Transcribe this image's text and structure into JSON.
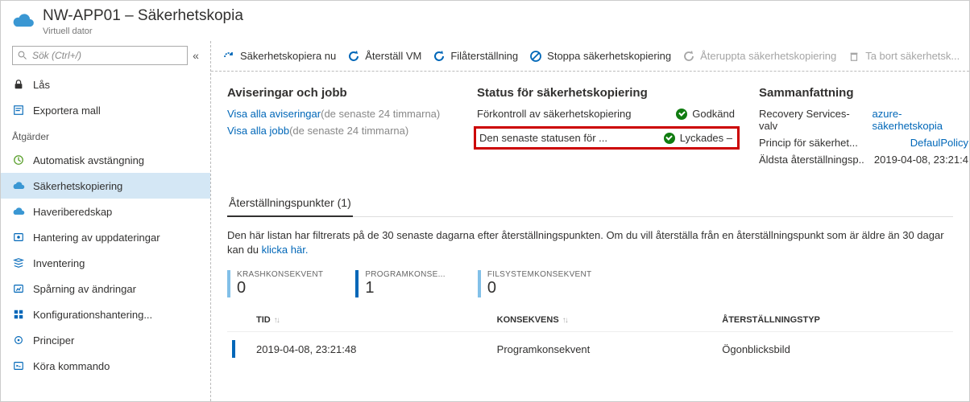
{
  "header": {
    "title": "NW-APP01 – Säkerhetskopia",
    "subtitle": "Virtuell dator"
  },
  "search": {
    "placeholder": "Sök (Ctrl+/)"
  },
  "sidebar": {
    "basic": [
      {
        "icon": "lock",
        "label": "Lås"
      },
      {
        "icon": "export",
        "label": "Exportera mall"
      }
    ],
    "section_label": "Åtgärder",
    "ops": [
      {
        "icon": "clock",
        "label": "Automatisk avstängning"
      },
      {
        "icon": "cloud",
        "label": "Säkerhetskopiering",
        "active": true
      },
      {
        "icon": "cloud",
        "label": "Haveriberedskap"
      },
      {
        "icon": "updates",
        "label": "Hantering av uppdateringar"
      },
      {
        "icon": "stack",
        "label": "Inventering"
      },
      {
        "icon": "track",
        "label": "Spårning av ändringar"
      },
      {
        "icon": "config",
        "label": "Konfigurationshantering..."
      },
      {
        "icon": "policy",
        "label": "Principer"
      },
      {
        "icon": "command",
        "label": "Köra kommando"
      }
    ]
  },
  "toolbar": {
    "backup_now": "Säkerhetskopiera nu",
    "restore_vm": "Återställ VM",
    "file_restore": "Filåterställning",
    "stop_backup": "Stoppa säkerhetskopiering",
    "resume_backup": "Återuppta säkerhetskopiering",
    "delete_backup": "Ta bort säkerhetsk..."
  },
  "alerts": {
    "heading": "Aviseringar och jobb",
    "view_alerts": "Visa alla aviseringar",
    "view_alerts_suffix": "(de senaste 24 timmarna)",
    "view_jobs": "Visa alla jobb",
    "view_jobs_suffix": "(de senaste 24 timmarna)"
  },
  "status": {
    "heading": "Status för säkerhetskopiering",
    "precheck_label": "Förkontroll av säkerhetskopiering",
    "precheck_value": "Godkänd",
    "last_label": "Den senaste statusen för ...",
    "last_value": "Lyckades –"
  },
  "summary": {
    "heading": "Sammanfattning",
    "vault_key": "Recovery Services-valv",
    "vault_val": "azure-säkerhetskopia",
    "policy_key": "Princip för säkerhet...",
    "policy_val": "DefaulPolicy",
    "oldest_key": "Äldsta återställningsp..",
    "oldest_val": "2019-04-08, 23:21:4"
  },
  "rp": {
    "tab": "Återställningspunkter (1)",
    "desc_a": "Den här listan har filtrerats på de 30 senaste dagarna efter återställningspunkten. Om du vill återställa från en återställningspunkt som är äldre än 30 dagar kan du ",
    "desc_link": "klicka här.",
    "metrics": {
      "crash_label": "KRASHKONSEKVENT",
      "crash_val": "0",
      "app_label": "PROGRAMKONSE...",
      "app_val": "1",
      "fs_label": "FILSYSTEMKONSEKVENT",
      "fs_val": "0"
    },
    "columns": {
      "time": "TID",
      "consistency": "KONSEKVENS",
      "recovery_type": "ÅTERSTÄLLNINGSTYP"
    },
    "rows": [
      {
        "time": "2019-04-08, 23:21:48",
        "consistency": "Programkonsekvent",
        "recovery_type": "Ögonblicksbild"
      }
    ]
  }
}
